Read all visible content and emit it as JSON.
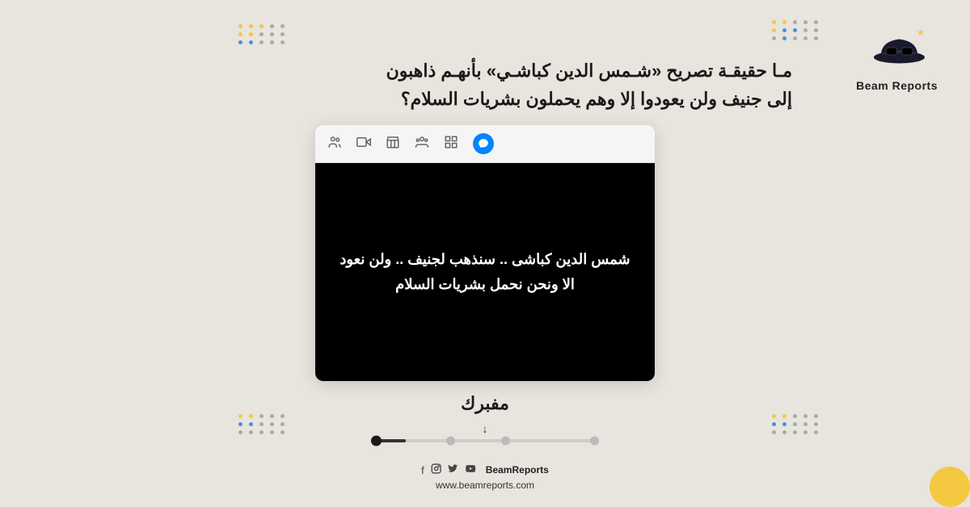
{
  "background": {
    "color": "#e8e4de"
  },
  "logo": {
    "title": "Beam Reports",
    "icon_alt": "detective hat icon"
  },
  "headline": {
    "line1": "مـا حقيقـة تصريح «شـمس الدين كباشـي» بأنهـم ذاهبون",
    "line2": "إلى جنيف ولن يعودوا إلا وهم يحملون بشريات السلام؟"
  },
  "browser": {
    "toolbar_icons": [
      "people",
      "video",
      "store",
      "group",
      "grid",
      "messenger"
    ]
  },
  "video": {
    "subtitle_line1": "شمس الدين كباشى .. سنذهب لجنيف .. ولن نعود",
    "subtitle_line2": "الا ونحن نحمل بشريات السلام"
  },
  "verdict": {
    "label": "مفبرك"
  },
  "timeline": {
    "arrow": "↓",
    "fill_percent": 15
  },
  "footer": {
    "social_label": "BeamReports",
    "website": "www.beamreports.com",
    "icons": [
      "f",
      "inst",
      "tw",
      "yt"
    ]
  },
  "decoration": {
    "dot_colors": [
      "#f5c842",
      "#4a90d9",
      "#bbbbbb"
    ]
  }
}
